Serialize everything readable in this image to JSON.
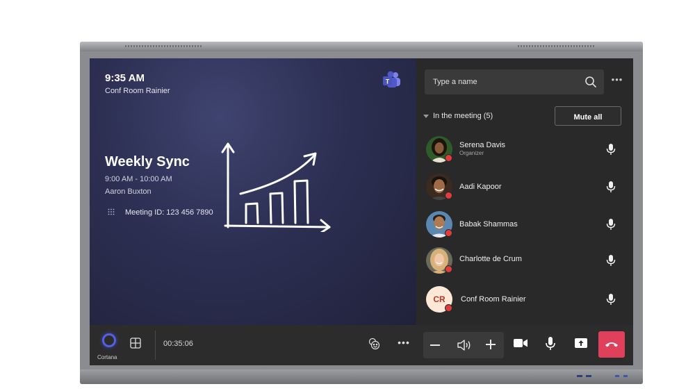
{
  "status": {
    "time": "9:35 AM",
    "room": "Conf Room Rainier"
  },
  "meeting": {
    "title": "Weekly Sync",
    "time_range": "9:00 AM - 10:00 AM",
    "organizer": "Aaron Buxton",
    "meeting_id_label": "Meeting ID: 123 456 7890"
  },
  "panel": {
    "search_placeholder": "Type a name",
    "more_label": "•••",
    "in_meeting_label": "In the meeting (5)",
    "mute_all_label": "Mute all",
    "participants": [
      {
        "name": "Serena Davis",
        "role": "Organizer",
        "avatar_color": "#5a3a28"
      },
      {
        "name": "Aadi Kapoor",
        "role": "",
        "avatar_color": "#6b4a2c"
      },
      {
        "name": "Babak Shammas",
        "role": "",
        "avatar_color": "#4a6a88"
      },
      {
        "name": "Charlotte de Crum",
        "role": "",
        "avatar_color": "#c9a070"
      },
      {
        "name": "Conf Room Rainier",
        "role": "",
        "initials": "CR",
        "avatar_color": "#fde8d8"
      }
    ]
  },
  "bottom": {
    "cortana_label": "Cortana",
    "elapsed": "00:35:06",
    "more_label": "•••"
  },
  "colors": {
    "hangup": "#e0405a",
    "cortana": "#5560e0",
    "presence_busy": "#e03c3c"
  },
  "icons": [
    "teams-logo-icon",
    "search-icon",
    "more-icon",
    "mic-icon",
    "cortana-icon",
    "layout-grid-icon",
    "reactions-icon",
    "volume-icon",
    "camera-icon",
    "share-screen-icon",
    "hang-up-icon",
    "dialpad-icon"
  ]
}
